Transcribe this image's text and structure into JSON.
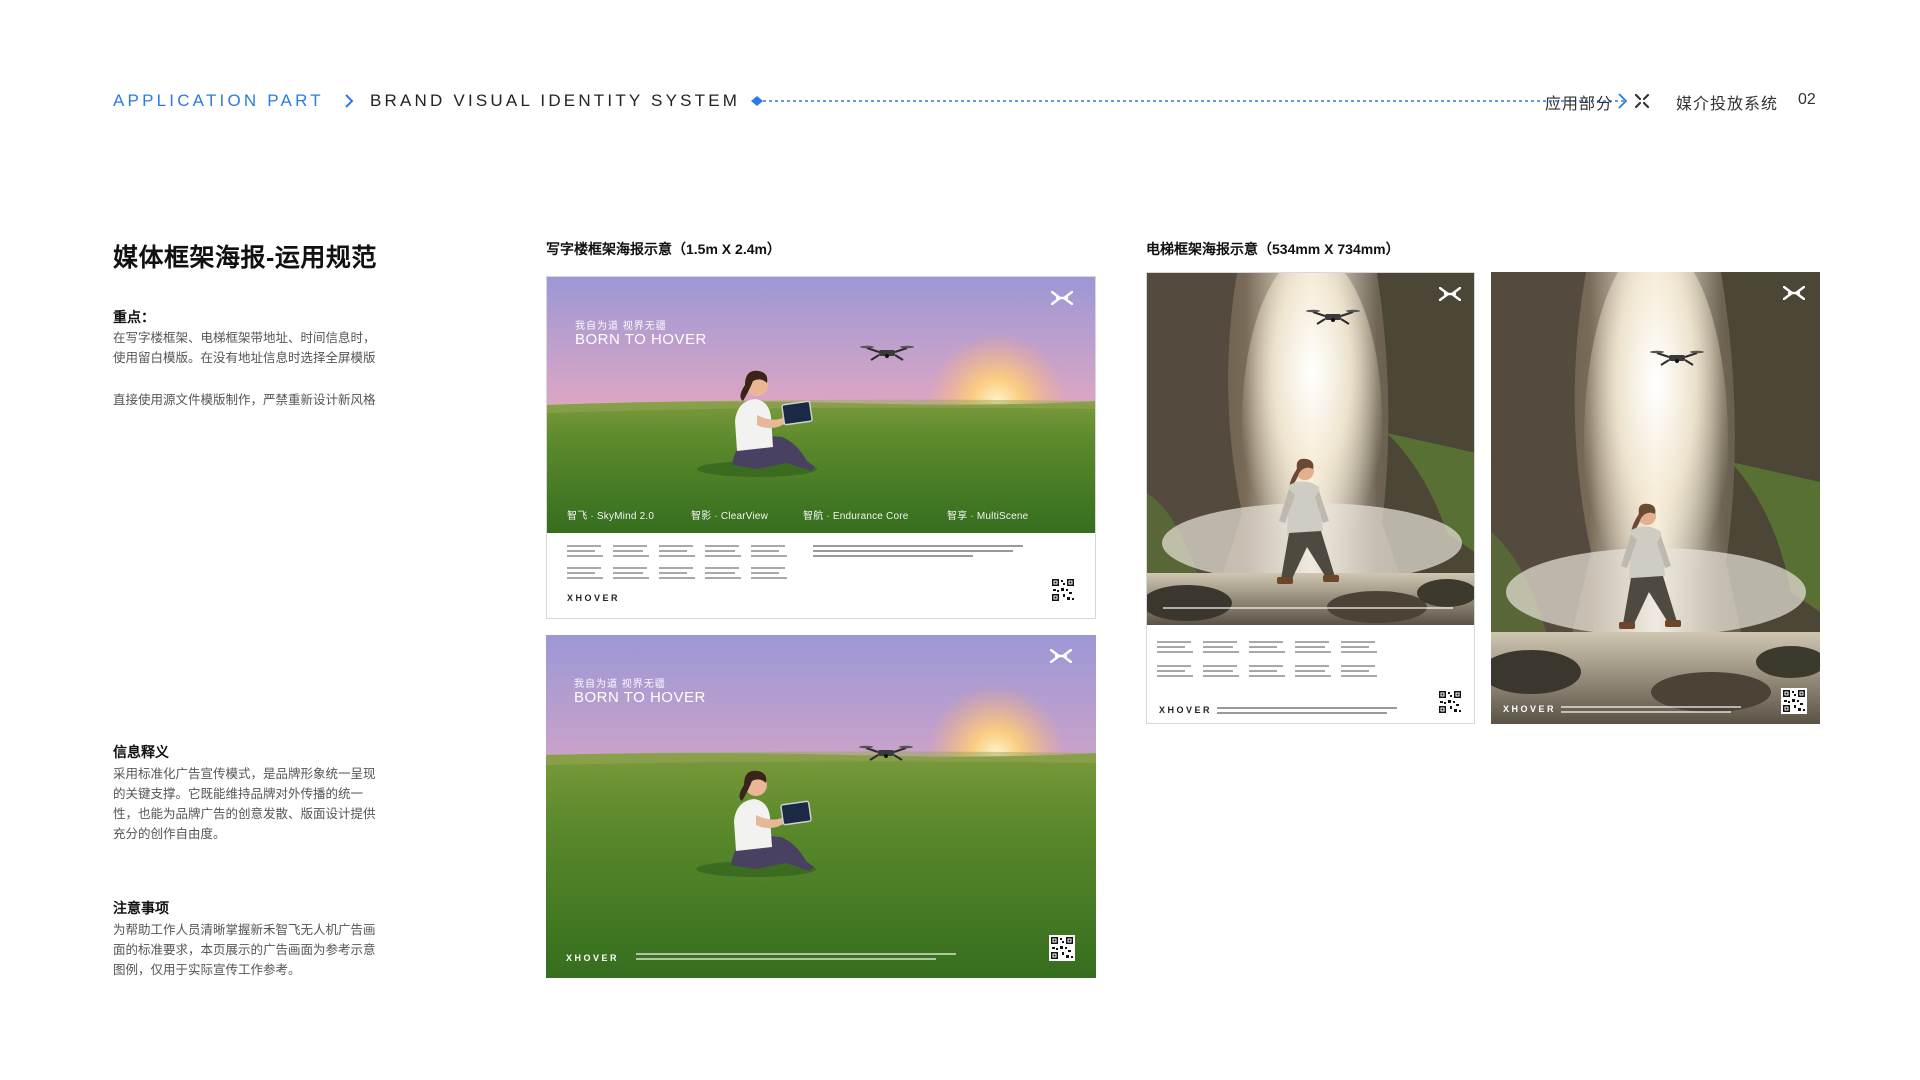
{
  "header": {
    "section_en": "APPLICATION PART",
    "system_en": "BRAND VISUAL IDENTITY SYSTEM",
    "section_cn": "应用部分",
    "system_cn": "媒介投放系统",
    "page_number": "02",
    "accent_color": "#2b7be5"
  },
  "left": {
    "title": "媒体框架海报-运用规范",
    "key_points": {
      "heading": "重点：",
      "lines": [
        "在写字楼框架、电梯框架带地址、时间信息时，",
        "使用留白模版。在没有地址信息时选择全屏模版"
      ],
      "note": "直接使用源文件模版制作，严禁重新设计新风格"
    },
    "info": {
      "heading": "信息释义",
      "lines": [
        "采用标准化广告宣传模式，是品牌形象统一呈现",
        "的关键支撑。它既能维持品牌对外传播的统一",
        "性，也能为品牌广告的创意发散、版面设计提供",
        "充分的创作自由度。"
      ]
    },
    "notice": {
      "heading": "注意事项",
      "lines": [
        "为帮助工作人员清晰掌握新禾智飞无人机广告画",
        "面的标准要求，本页展示的广告画面为参考示意",
        "图例，仅用于实际宣传工作参考。"
      ]
    }
  },
  "office_frame": {
    "caption": "写字楼框架海报示意（1.5m X 2.4m）"
  },
  "elevator_frame": {
    "caption": "电梯框架海报示意（534mm X 734mm）"
  },
  "poster": {
    "tagline": "我自为道 视界无疆",
    "slogan": "BORN TO HOVER",
    "brand": "XHOVER",
    "features": [
      "智飞 · SkyMind 2.0",
      "智影 · ClearView",
      "智航 · Endurance Core",
      "智享 · MultiScene"
    ],
    "icons": [
      "brand-mark-icon",
      "qr-code-icon",
      "drone-icon"
    ]
  }
}
